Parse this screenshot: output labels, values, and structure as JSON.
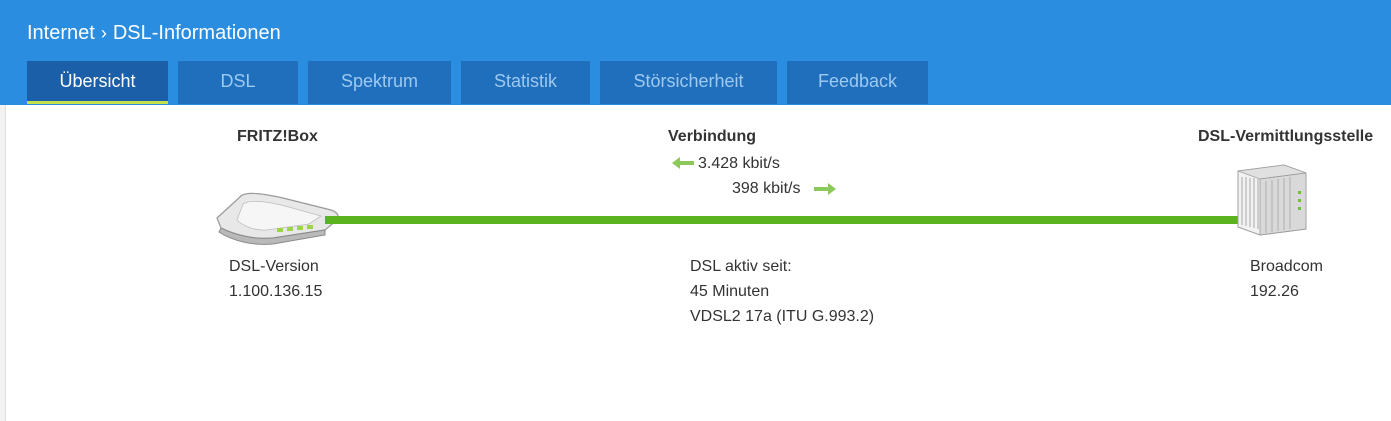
{
  "breadcrumb": {
    "section": "Internet",
    "page": "DSL-Informationen",
    "separator": "›"
  },
  "tabs": [
    {
      "label": "Übersicht",
      "active": true
    },
    {
      "label": "DSL",
      "active": false
    },
    {
      "label": "Spektrum",
      "active": false
    },
    {
      "label": "Statistik",
      "active": false
    },
    {
      "label": "Störsicherheit",
      "active": false
    },
    {
      "label": "Feedback",
      "active": false
    }
  ],
  "fritzbox": {
    "title": "FRITZ!Box",
    "version_label": "DSL-Version",
    "version_value": "1.100.136.15"
  },
  "connection": {
    "title": "Verbindung",
    "downstream": "3.428 kbit/s",
    "upstream": "398 kbit/s",
    "active_label": "DSL aktiv seit:",
    "active_duration": "45 Minuten",
    "standard": "VDSL2 17a (ITU G.993.2)"
  },
  "exchange": {
    "title": "DSL-Vermittlungsstelle",
    "vendor_label": "Broadcom",
    "vendor_value": "192.26"
  },
  "colors": {
    "header": "#2a8de0",
    "tab": "#1f6fbd",
    "tab_active_underline": "#c4e04a",
    "line": "#5ab31f",
    "arrow": "#8cc85a"
  },
  "icons": {
    "router": "fritzbox-router-icon",
    "exchange": "dslam-rack-icon",
    "down_arrow": "arrow-left-icon",
    "up_arrow": "arrow-right-icon"
  }
}
